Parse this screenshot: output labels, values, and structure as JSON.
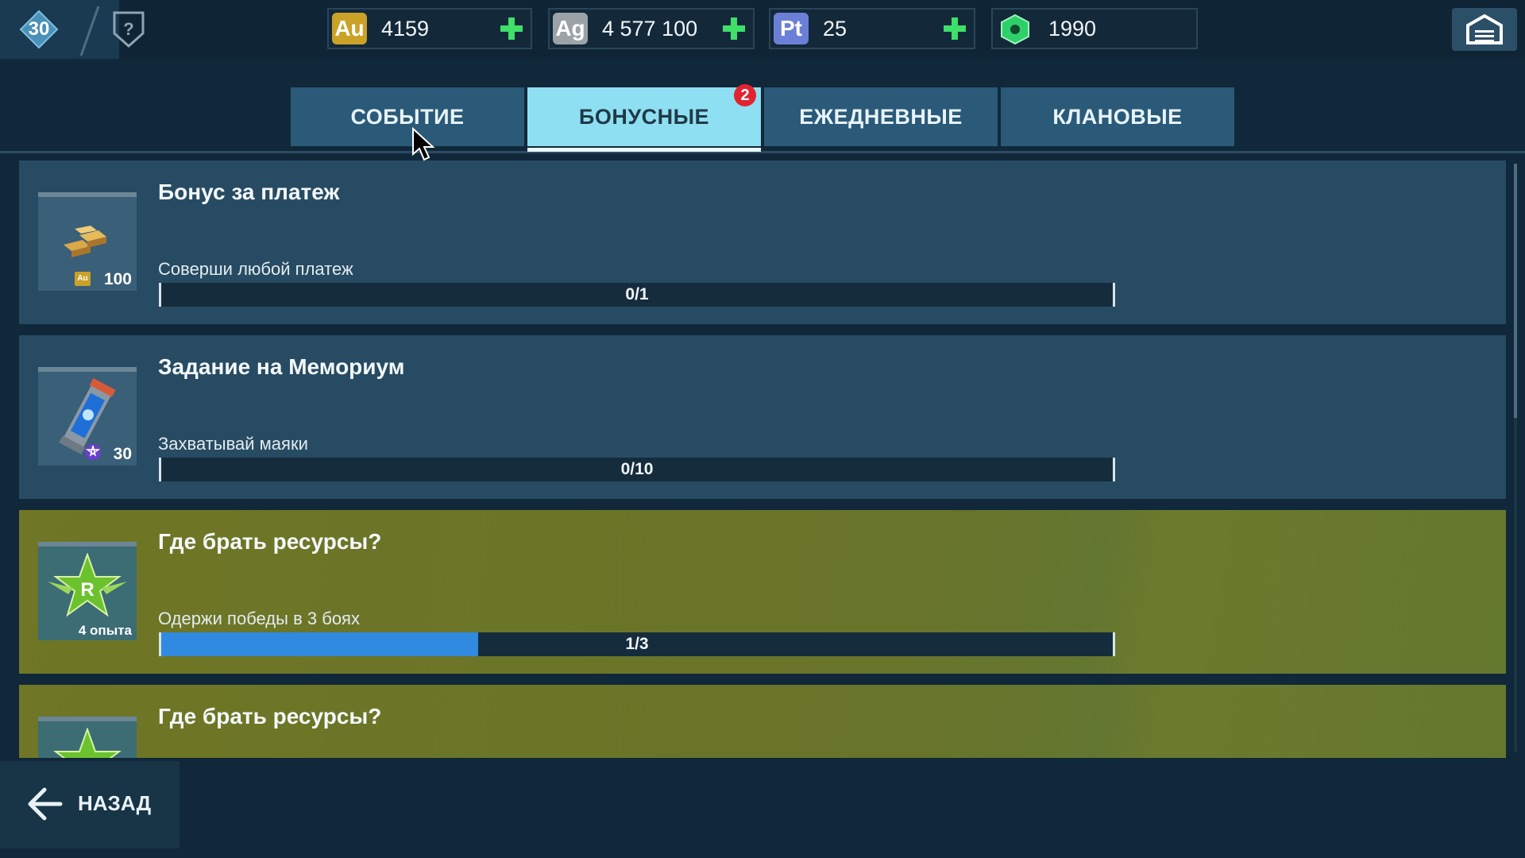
{
  "player": {
    "level": "30"
  },
  "currencies": [
    {
      "code": "Au",
      "value": "4159",
      "color": "#c9a227",
      "has_plus": true
    },
    {
      "code": "Ag",
      "value": "4 577 100",
      "color": "#9ba3a8",
      "has_plus": true
    },
    {
      "code": "Pt",
      "value": "25",
      "color": "#6c7fd6",
      "has_plus": true
    },
    {
      "code": "hex-gem-icon",
      "value": "1990",
      "color": "#2fcf6a",
      "has_plus": false
    }
  ],
  "tabs": [
    {
      "label": "СОБЫТИЕ",
      "active": false
    },
    {
      "label": "БОНУСНЫЕ",
      "active": true,
      "badge": "2"
    },
    {
      "label": "ЕЖЕДНЕВНЫЕ",
      "active": false
    },
    {
      "label": "КЛАНОВЫЕ",
      "active": false
    }
  ],
  "quests": [
    {
      "title": "Бонус за платеж",
      "desc": "Соверши любой платеж",
      "progress_text": "0/1",
      "progress": 0,
      "reward": "100",
      "reward_icon": "gold-bars-icon",
      "style": "blue"
    },
    {
      "title": "Задание на Мемориум",
      "desc": "Захватывай маяки",
      "progress_text": "0/10",
      "progress": 0,
      "reward": "30",
      "reward_icon": "memorium-canister-icon",
      "style": "blue"
    },
    {
      "title": "Где брать ресурсы?",
      "desc": "Одержи победы в 3 боях",
      "progress_text": "1/3",
      "progress": 0.333,
      "reward": "4 опыта",
      "reward_icon": "rank-star-icon",
      "style": "gold"
    },
    {
      "title": "Где брать ресурсы?",
      "desc": "",
      "progress_text": "",
      "progress": 0,
      "reward": "",
      "reward_icon": "rank-star-icon",
      "style": "gold"
    }
  ],
  "footer": {
    "back_label": "НАЗАД"
  },
  "colors": {
    "accent_tab": "#8fdff2",
    "progress_fill": "#2f8ae0",
    "badge": "#e2232f"
  }
}
